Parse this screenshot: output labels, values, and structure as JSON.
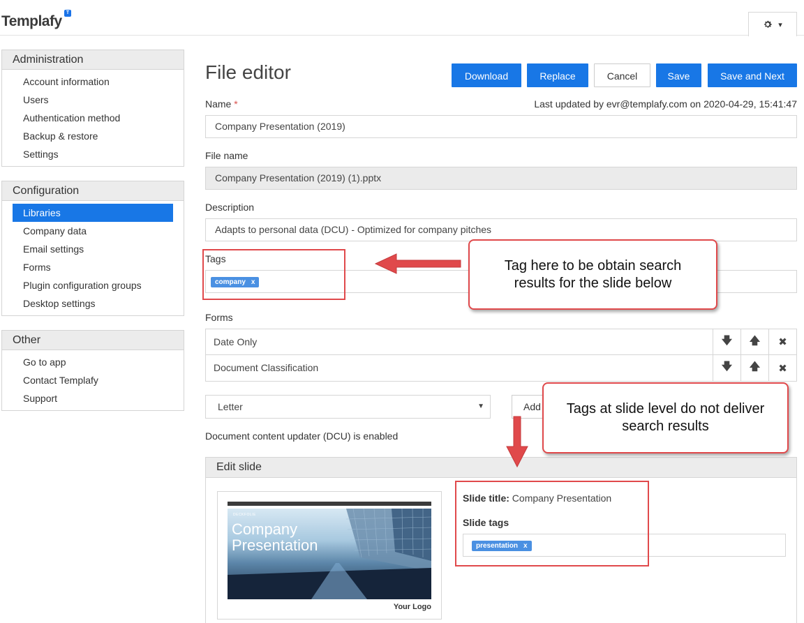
{
  "header": {
    "logo_text": "Templafy",
    "logo_badge": "T",
    "settings_icon": "gear-icon",
    "settings_caret": "▾"
  },
  "sidebar": {
    "administration": {
      "title": "Administration",
      "items": [
        "Account information",
        "Users",
        "Authentication method",
        "Backup & restore",
        "Settings"
      ]
    },
    "configuration": {
      "title": "Configuration",
      "items": [
        "Libraries",
        "Company data",
        "Email settings",
        "Forms",
        "Plugin configuration groups",
        "Desktop settings"
      ],
      "active_item": "Libraries"
    },
    "other": {
      "title": "Other",
      "items": [
        "Go to app",
        "Contact Templafy",
        "Support"
      ]
    }
  },
  "main": {
    "title": "File editor",
    "buttons": {
      "download": "Download",
      "replace": "Replace",
      "cancel": "Cancel",
      "save": "Save",
      "save_next": "Save and Next"
    },
    "name_label": "Name",
    "required_mark": "*",
    "last_updated": "Last updated by evr@templafy.com on 2020-04-29, 15:41:47",
    "name_value": "Company Presentation (2019)",
    "file_name_label": "File name",
    "file_name_value": "Company Presentation (2019) (1).pptx",
    "description_label": "Description",
    "description_value": "Adapts to personal data (DCU) - Optimized for company pitches",
    "tags_label": "Tags",
    "tags": [
      {
        "label": "company",
        "remove": "x"
      }
    ],
    "forms_label": "Forms",
    "forms": [
      {
        "name": "Date Only",
        "down": "🡇",
        "up": "🡅",
        "remove": "✖"
      },
      {
        "name": "Document Classification",
        "down": "🡇",
        "up": "🡅",
        "remove": "✖"
      }
    ],
    "form_select_value": "Letter",
    "form_select_caret": "▼",
    "add_button_partial": "Add",
    "dcu_text": "Document content updater (DCU) is enabled",
    "edit_slide": {
      "heading": "Edit slide",
      "thumbnail": {
        "small_text": "DECKFOLIE",
        "title_line1": "Company",
        "title_line2": "Presentation",
        "logo_text": "Your Logo"
      },
      "slide_title_label": "Slide title:",
      "slide_title_value": "Company Presentation",
      "slide_tags_label": "Slide tags",
      "slide_tags": [
        {
          "label": "presentation",
          "remove": "x"
        }
      ]
    }
  },
  "annotations": {
    "callout_tags": "Tag here to be obtain search results for the slide below",
    "callout_slide": "Tags at slide level do not deliver search results",
    "color": "#e0494b"
  },
  "colors": {
    "primary": "#1877e6",
    "tag": "#4a90e2",
    "header_bg": "#ececec"
  }
}
